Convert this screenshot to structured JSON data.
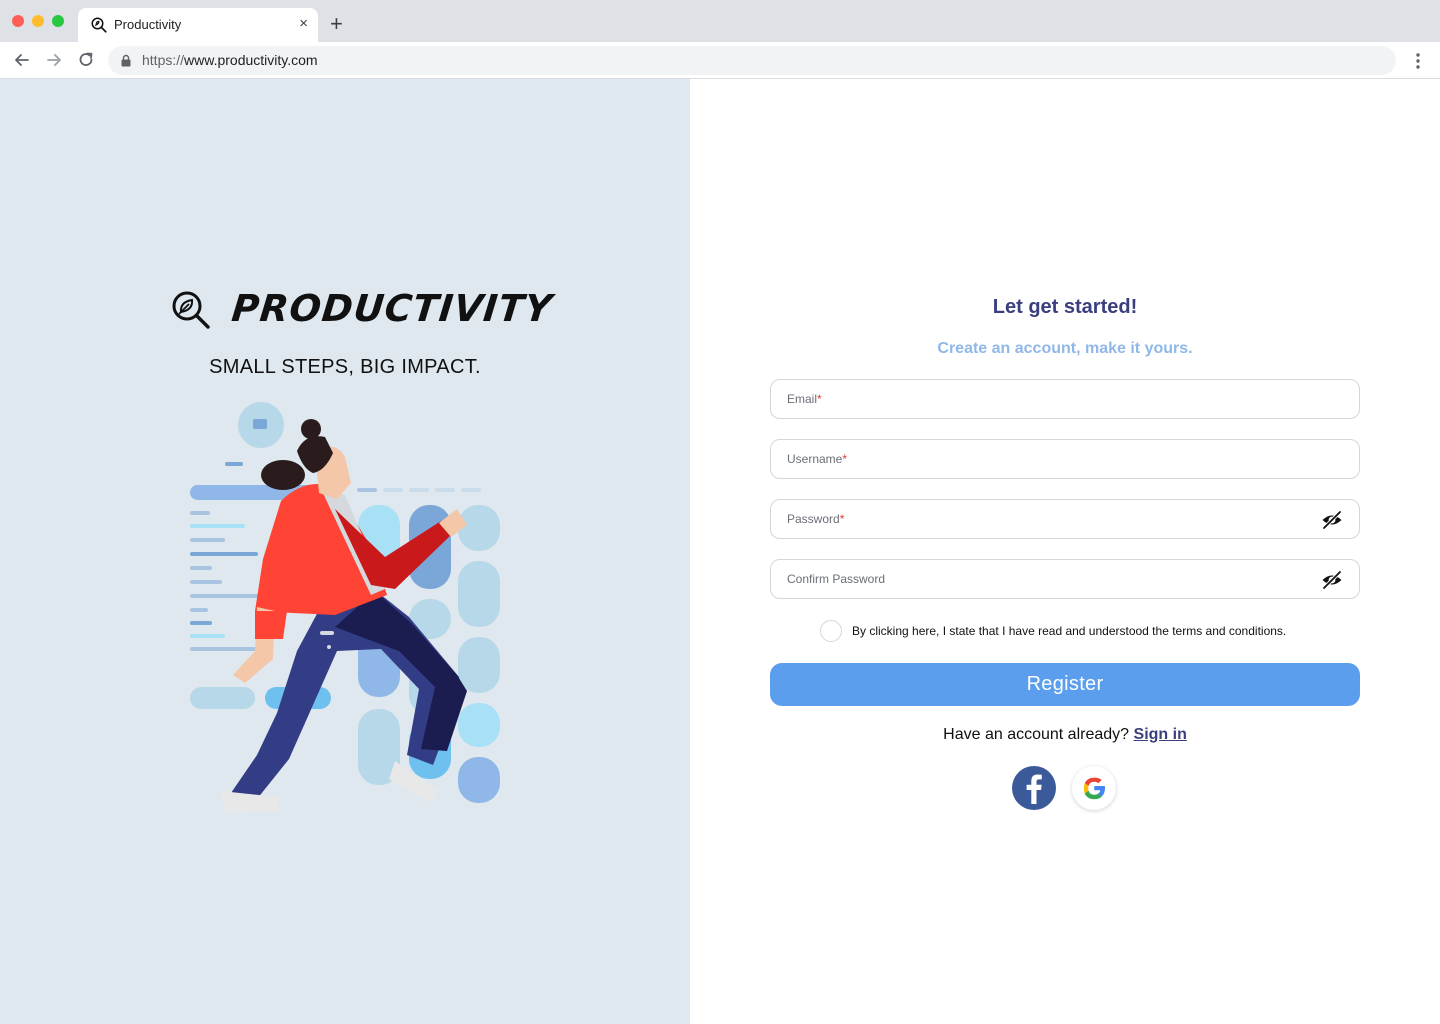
{
  "browser": {
    "tab_title": "Productivity",
    "tab_close": "×",
    "new_tab": "+",
    "url_scheme": "https://",
    "url_host": "www.productivity.com",
    "traffic_lights": [
      "#ff5f57",
      "#febc2e",
      "#28c840"
    ]
  },
  "brand": {
    "name": "PRODUCTIVITY",
    "tagline": "SMALL STEPS, BIG IMPACT."
  },
  "form": {
    "title": "Let get started!",
    "subtitle": "Create an account, make it yours.",
    "fields": [
      {
        "label": "Email",
        "required": "*"
      },
      {
        "label": "Username",
        "required": "*"
      },
      {
        "label": "Password",
        "required": "*"
      },
      {
        "label": "Confirm Password",
        "required": ""
      }
    ],
    "terms": "By clicking here, I state that I have read and understood the terms and conditions.",
    "register_label": "Register",
    "signin_prompt": "Have an account already?",
    "signin_link": "Sign in"
  },
  "colors": {
    "left_bg": "#dfe8ef",
    "accent": "#5a9eed",
    "title": "#3b3f7e",
    "subtitle": "#8fb8e8",
    "facebook": "#3b5a9a"
  },
  "icons": [
    "magnifier-leaf-icon",
    "lock-icon",
    "eye-off-icon",
    "facebook-icon",
    "google-icon"
  ]
}
